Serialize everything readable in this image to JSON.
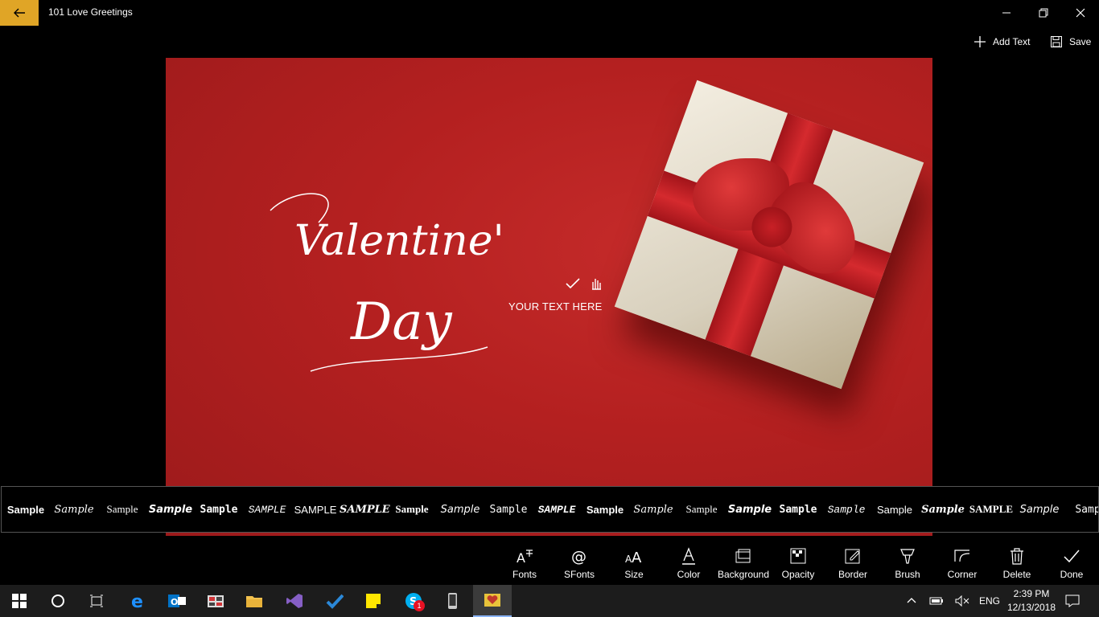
{
  "window": {
    "title": "101 Love Greetings"
  },
  "commands": {
    "add_text": "Add Text",
    "save": "Save"
  },
  "canvas": {
    "overlay_text": "YOUR TEXT HERE",
    "art_text_line1": "Valentine's",
    "art_text_line2": "Day"
  },
  "font_samples": [
    "Sample",
    "Sample",
    "Sample",
    "Sample",
    "Sample",
    "SAMPLE",
    "SAMPLE",
    "SAMPLE",
    "Sample",
    "Sample",
    "Sample",
    "SAMPLE",
    "Sample",
    "Sample",
    "Sample",
    "Sample",
    "Sample",
    "Sample",
    "Sample",
    "Sample",
    "SAMPLE",
    "Sample",
    "Samp"
  ],
  "toolbar": {
    "fonts": "Fonts",
    "sfonts": "SFonts",
    "size": "Size",
    "color": "Color",
    "background": "Background",
    "opacity": "Opacity",
    "border": "Border",
    "brush": "Brush",
    "corner": "Corner",
    "delete": "Delete",
    "done": "Done"
  },
  "taskbar": {
    "language": "ENG",
    "time": "2:39 PM",
    "date": "12/13/2018",
    "skype_badge": "1"
  },
  "colors": {
    "accent": "#e0a526",
    "canvas_red": "#b42020"
  }
}
